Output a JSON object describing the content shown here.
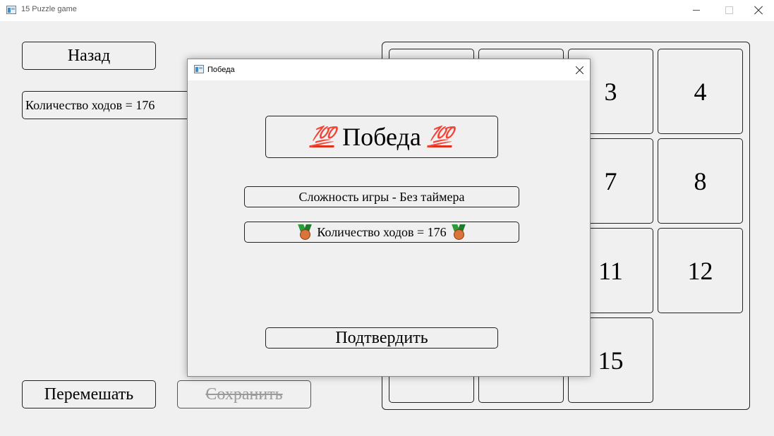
{
  "window": {
    "title": "15 Puzzle game"
  },
  "left_panel": {
    "back_label": "Назад",
    "moves_text": "Количество ходов = 176",
    "shuffle_label": "Перемешать",
    "save_label": "Сохранить"
  },
  "board": {
    "visible_tiles": [
      "3",
      "4",
      "7",
      "8",
      "11",
      "12",
      "15"
    ]
  },
  "dialog": {
    "title": "Победа",
    "banner_text": "Победа",
    "banner_emoji": "💯",
    "difficulty_text": "Сложность игры - Без таймера",
    "moves_text": "Количество ходов = 176",
    "medal_icon": "bronze-medal-icon",
    "confirm_label": "Подтвердить"
  },
  "colors": {
    "background": "#f0f0f0",
    "emoji_red": "#e0321a",
    "disabled_text": "#9a9a9a"
  }
}
